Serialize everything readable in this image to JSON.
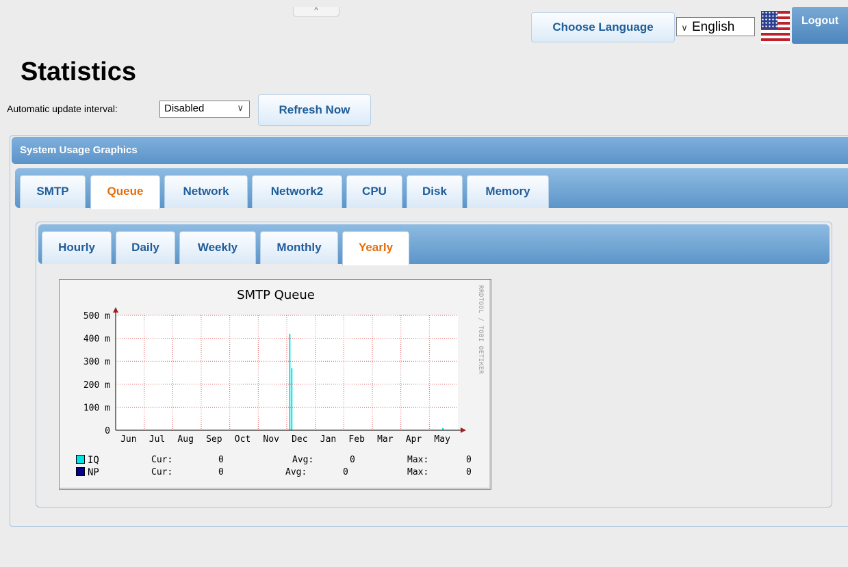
{
  "header": {
    "collapse_glyph": "^",
    "choose_language_label": "Choose Language",
    "language_selected": "English",
    "chevron_glyph": "∨",
    "logout_label": "Logout"
  },
  "page": {
    "title": "Statistics",
    "interval_label": "Automatic update interval:",
    "interval_selected": "Disabled",
    "refresh_label": "Refresh Now"
  },
  "panel": {
    "title": "System Usage Graphics",
    "tabs": [
      {
        "label": "SMTP",
        "active": false
      },
      {
        "label": "Queue",
        "active": true
      },
      {
        "label": "Network",
        "active": false
      },
      {
        "label": "Network2",
        "active": false
      },
      {
        "label": "CPU",
        "active": false
      },
      {
        "label": "Disk",
        "active": false
      },
      {
        "label": "Memory",
        "active": false
      }
    ],
    "subtabs": [
      {
        "label": "Hourly",
        "active": false
      },
      {
        "label": "Daily",
        "active": false
      },
      {
        "label": "Weekly",
        "active": false
      },
      {
        "label": "Monthly",
        "active": false
      },
      {
        "label": "Yearly",
        "active": true
      }
    ]
  },
  "colors": {
    "accent_blue": "#1f5d99",
    "active_tab": "#e46d0a",
    "iq": "#00e5e5",
    "np": "#00008b",
    "grid": "#e06060",
    "axis_arrow": "#a02020"
  },
  "chart_data": {
    "type": "bar",
    "title": "SMTP Queue",
    "credit": "RRDTOOL / TOBI OETIKER",
    "categories": [
      "Jun",
      "Jul",
      "Aug",
      "Sep",
      "Oct",
      "Nov",
      "Dec",
      "Jan",
      "Feb",
      "Mar",
      "Apr",
      "May"
    ],
    "yticks": [
      "0",
      "100 m",
      "200 m",
      "300 m",
      "400 m",
      "500 m"
    ],
    "ylim": [
      0,
      0.5
    ],
    "grid": true,
    "series": [
      {
        "name": "IQ",
        "points": [
          {
            "x": "Dec",
            "offset": 0.08,
            "value": 0.42
          },
          {
            "x": "Dec",
            "offset": 0.15,
            "value": 0.27
          },
          {
            "x": "May",
            "offset": 0.45,
            "value": 0.01
          }
        ]
      },
      {
        "name": "NP",
        "points": []
      }
    ],
    "legend": [
      {
        "name": "IQ",
        "cur_label": "Cur:",
        "cur": "0",
        "avg_label": "Avg:",
        "avg": "0",
        "max_label": "Max:",
        "max": "0"
      },
      {
        "name": "NP",
        "cur_label": "Cur:",
        "cur": "0",
        "avg_label": "Avg:",
        "avg": "0",
        "max_label": "Max:",
        "max": "0"
      }
    ]
  }
}
